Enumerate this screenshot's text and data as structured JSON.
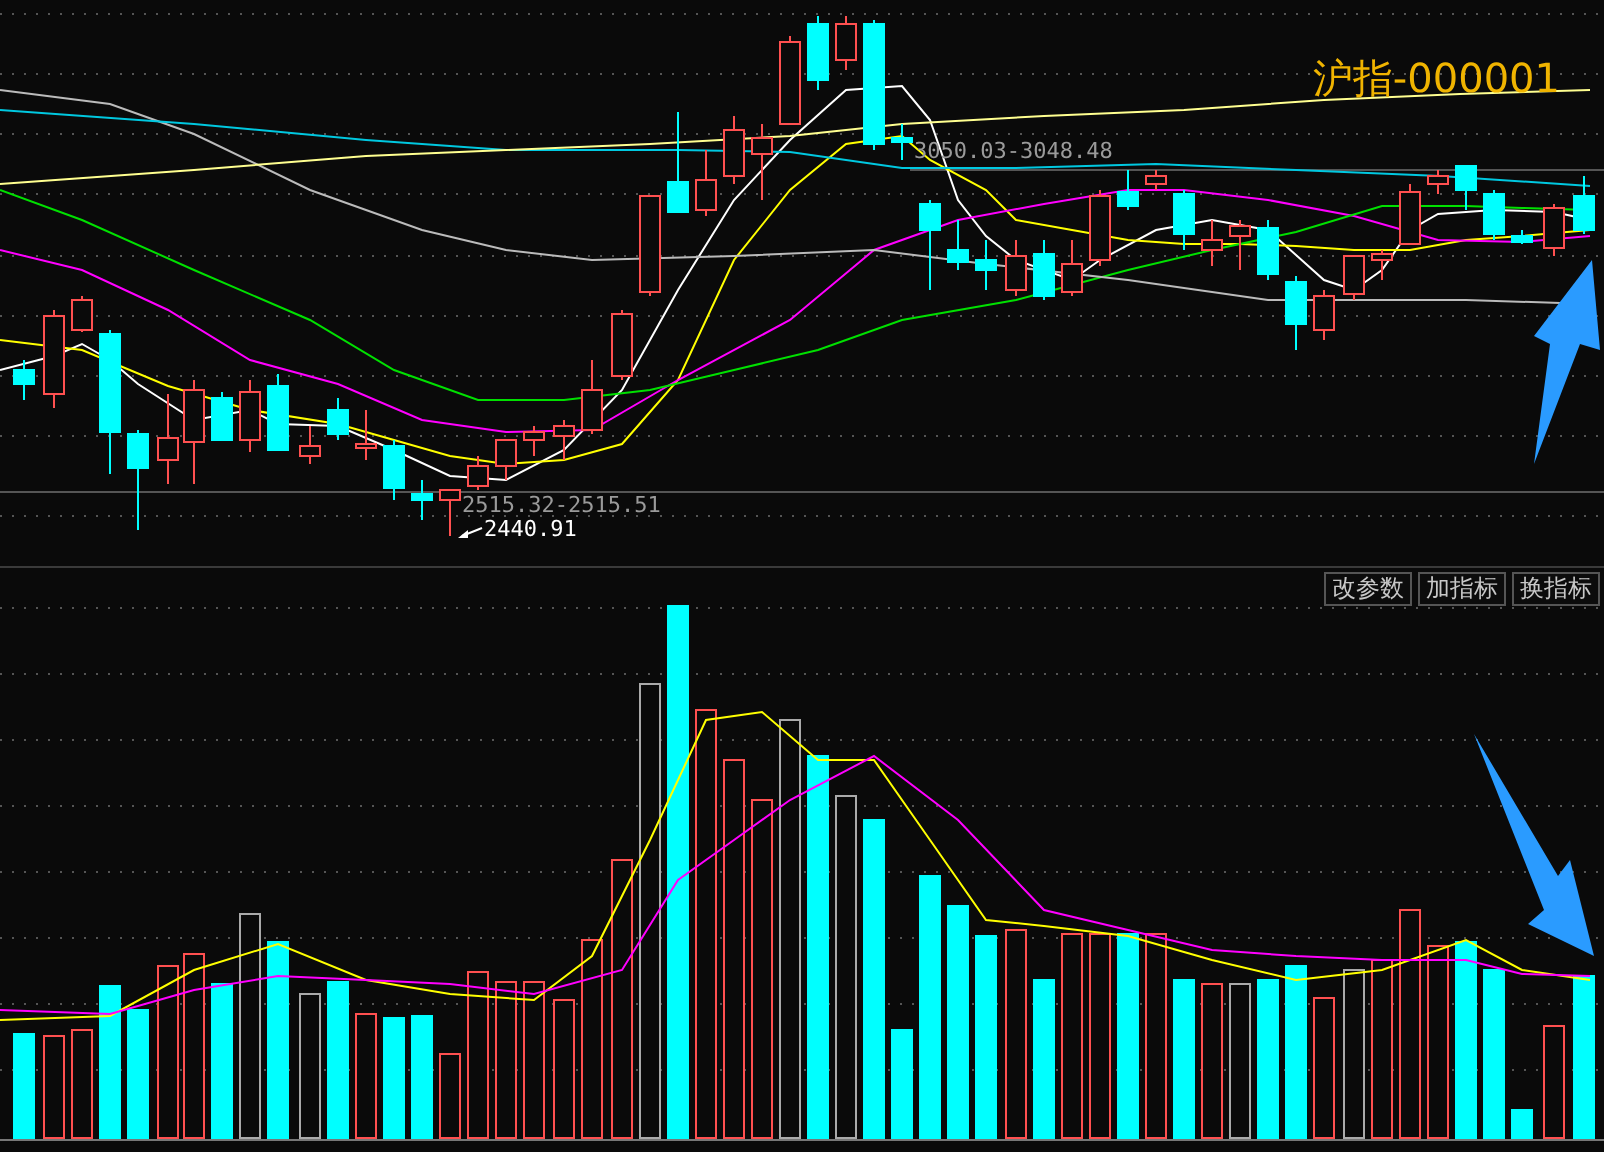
{
  "title": "沪指-000001",
  "range_labels": [
    "3050.03-3048.48",
    "2515.32-2515.51"
  ],
  "low_label": "2440.91",
  "buttons": [
    "改参数",
    "加指标",
    "换指标"
  ]
}
